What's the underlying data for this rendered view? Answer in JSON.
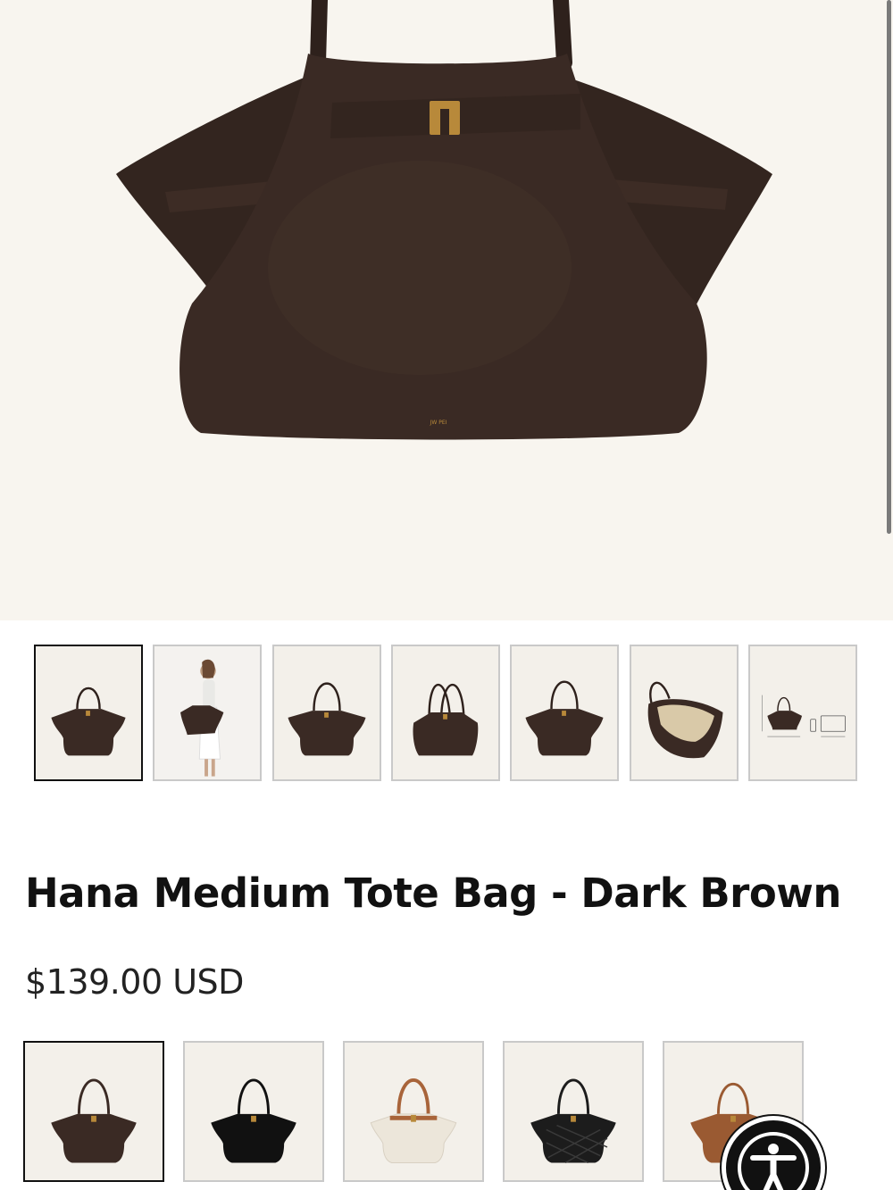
{
  "product": {
    "title": "Hana Medium Tote Bag - Dark Brown",
    "price": "$139.00 USD",
    "brand_mark": "JW PEI"
  },
  "gallery": {
    "selected_index": 0,
    "thumbnails": [
      {
        "icon": "bag-front-icon"
      },
      {
        "icon": "model-photo-icon"
      },
      {
        "icon": "bag-front-icon"
      },
      {
        "icon": "bag-side-icon"
      },
      {
        "icon": "bag-front-icon"
      },
      {
        "icon": "bag-interior-icon"
      },
      {
        "icon": "size-chart-icon"
      }
    ]
  },
  "colors": {
    "selected_index": 0,
    "swatches": [
      {
        "color": "#3a2a24",
        "handle": "#3a2a24"
      },
      {
        "color": "#111111",
        "handle": "#111111"
      },
      {
        "color": "#ece6da",
        "handle": "#a8643a"
      },
      {
        "color": "#1c1c1c",
        "handle": "#1c1c1c"
      },
      {
        "color": "#9a5a32",
        "handle": "#9a5a32"
      }
    ]
  },
  "theme": {
    "bag_color": "#3a2a24",
    "hero_bg": "#f8f5ef",
    "hardware_gold": "#b8893a"
  },
  "accessibility_button": {
    "icon": "accessibility-icon"
  }
}
